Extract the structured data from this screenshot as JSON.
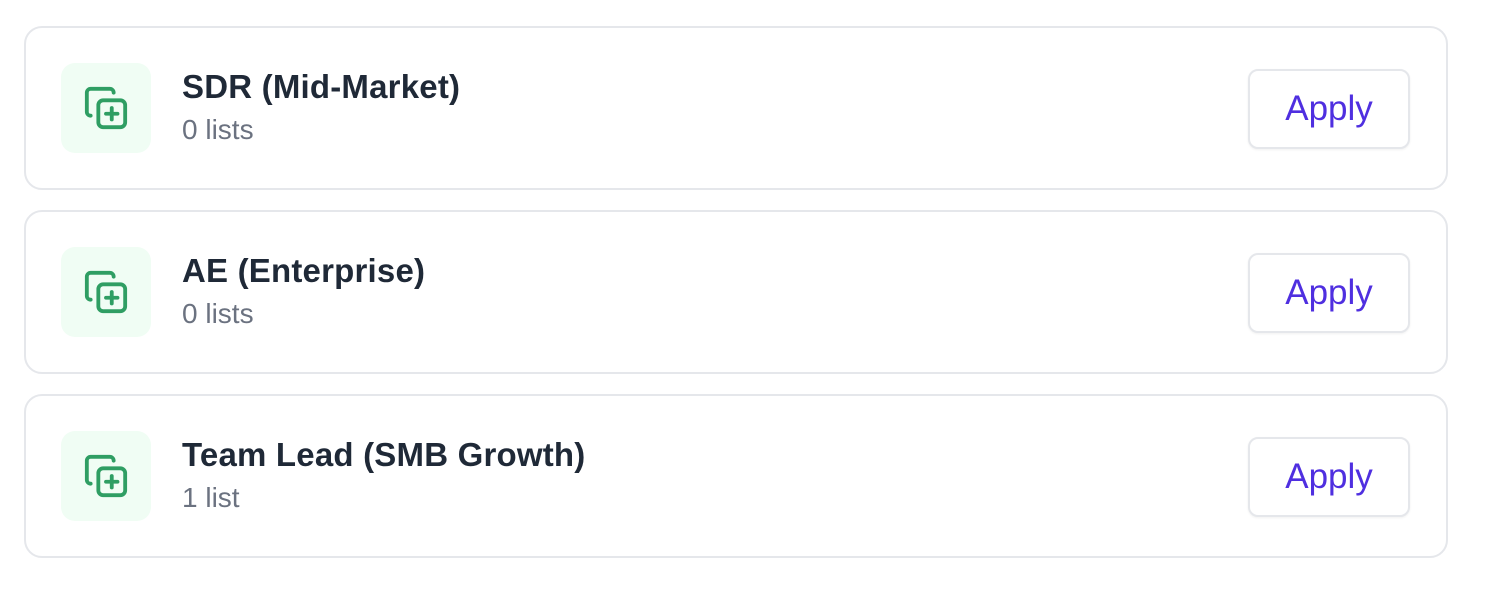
{
  "colors": {
    "icon_green": "#2f9e63",
    "icon_bg": "#f0fdf4",
    "apply_text": "#4f2fe0",
    "title_text": "#1f2937",
    "subtitle_text": "#6b7280"
  },
  "items": [
    {
      "title": "SDR (Mid-Market)",
      "subtitle": "0 lists",
      "icon": "copy-plus-icon",
      "button_label": "Apply"
    },
    {
      "title": "AE (Enterprise)",
      "subtitle": "0 lists",
      "icon": "copy-plus-icon",
      "button_label": "Apply"
    },
    {
      "title": "Team Lead (SMB Growth)",
      "subtitle": "1 list",
      "icon": "copy-plus-icon",
      "button_label": "Apply"
    }
  ]
}
